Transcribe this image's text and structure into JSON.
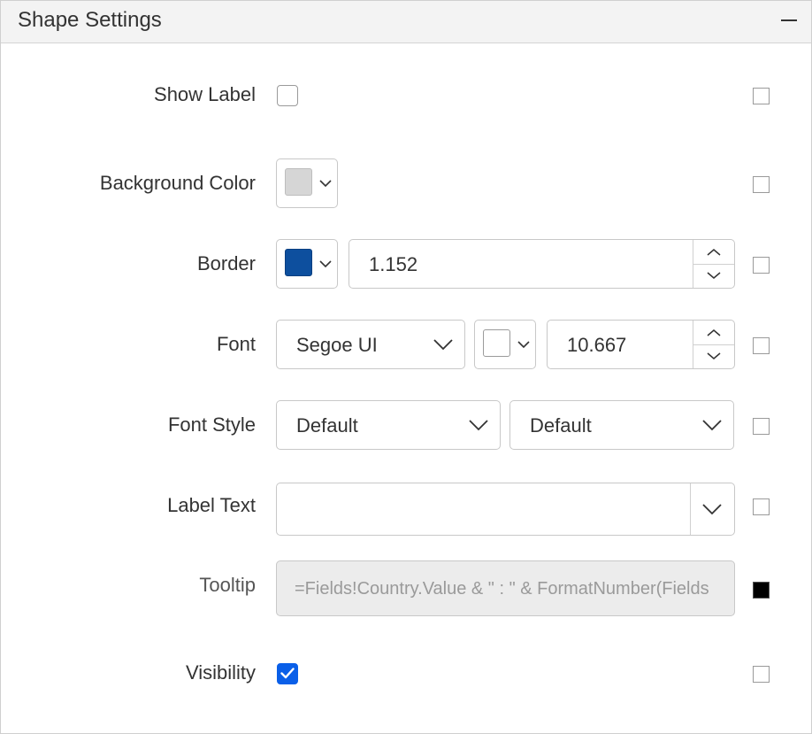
{
  "header": {
    "title": "Shape Settings",
    "collapse_icon": "minus-icon"
  },
  "rows": {
    "show_label": {
      "label": "Show Label",
      "checked": false
    },
    "background_color": {
      "label": "Background Color",
      "color": "#d6d6d6"
    },
    "border": {
      "label": "Border",
      "color": "#0d4f9e",
      "width_value": "1.152"
    },
    "font": {
      "label": "Font",
      "family": "Segoe UI",
      "color": "#ffffff",
      "size_value": "10.667"
    },
    "font_style": {
      "label": "Font Style",
      "style": "Default",
      "weight": "Default"
    },
    "label_text": {
      "label": "Label Text",
      "value": ""
    },
    "tooltip": {
      "label": "Tooltip",
      "value": "=Fields!Country.Value & \" : \" & FormatNumber(Fields"
    },
    "visibility": {
      "label": "Visibility",
      "checked": true
    }
  },
  "colors": {
    "accent": "#0a5fe8",
    "border": "#c8c8c8",
    "header_bg": "#f3f3f3"
  }
}
